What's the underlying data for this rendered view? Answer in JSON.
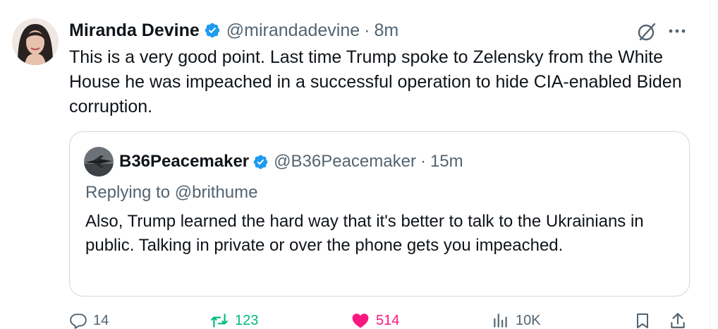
{
  "tweet": {
    "author_name": "Miranda Devine",
    "handle": "@mirandadevine",
    "separator": "·",
    "time": "8m",
    "text": "This is a very good point. Last time Trump spoke to Zelensky from the White House he was impeached in a successful operation to hide CIA-enabled Biden corruption."
  },
  "quoted": {
    "author_name": "B36Peacemaker",
    "handle": "@B36Peacemaker",
    "separator": "·",
    "time": "15m",
    "replying_prefix": "Replying to",
    "replying_to": "@brithume",
    "text": "Also, Trump learned the hard way that it's better to talk to the Ukrainians in public. Talking in private or over the phone gets you impeached."
  },
  "actions": {
    "replies": "14",
    "reposts": "123",
    "likes": "514",
    "views": "10K"
  },
  "icons": {
    "verified": "verified-badge-icon",
    "grok": "grok-icon",
    "more": "more-icon",
    "reply": "reply-icon",
    "repost": "repost-icon",
    "like": "heart-icon",
    "views": "views-icon",
    "bookmark": "bookmark-icon",
    "share": "share-icon"
  },
  "colors": {
    "verified": "#1d9bf0",
    "repost_active": "#00ba7c",
    "like_active": "#f91880",
    "secondary_text": "#536471",
    "border": "#cfd9de"
  }
}
